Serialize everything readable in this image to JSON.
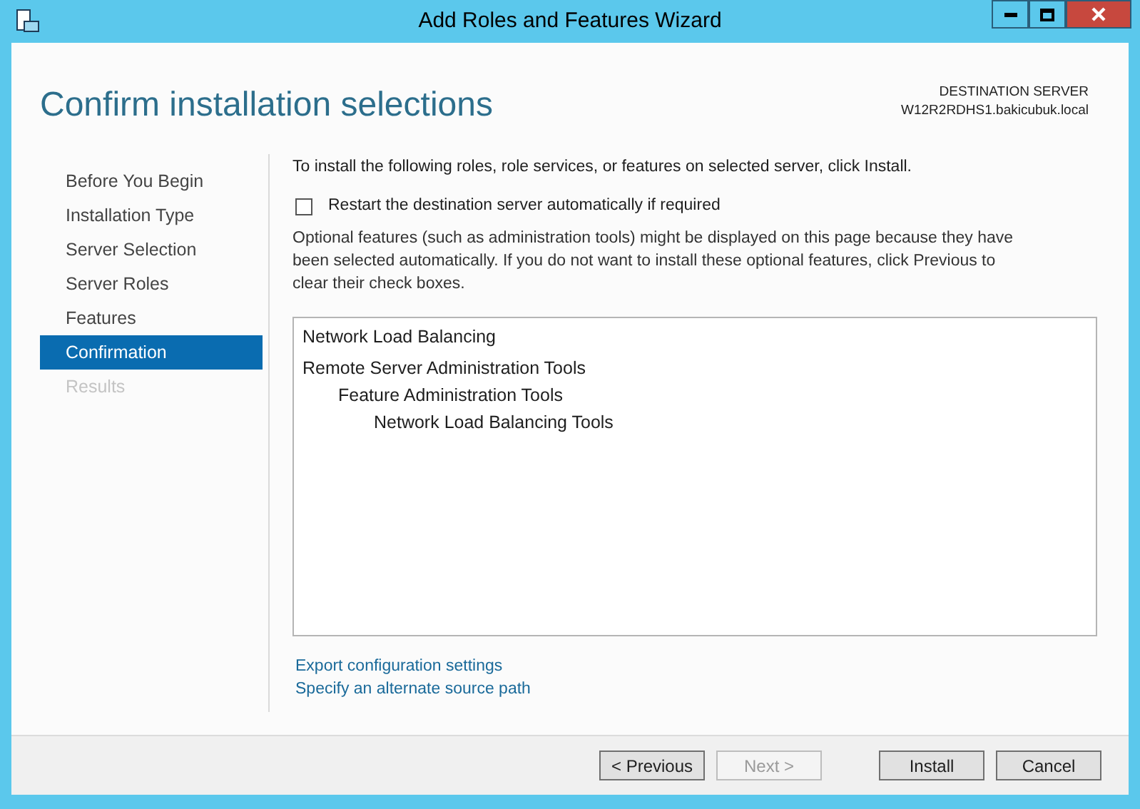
{
  "window": {
    "title": "Add Roles and Features Wizard"
  },
  "header": {
    "title": "Confirm installation selections",
    "destination_label": "DESTINATION SERVER",
    "destination_server": "W12R2RDHS1.bakicubuk.local"
  },
  "sidebar": {
    "items": [
      {
        "label": "Before You Begin",
        "selected": false,
        "disabled": false
      },
      {
        "label": "Installation Type",
        "selected": false,
        "disabled": false
      },
      {
        "label": "Server Selection",
        "selected": false,
        "disabled": false
      },
      {
        "label": "Server Roles",
        "selected": false,
        "disabled": false
      },
      {
        "label": "Features",
        "selected": false,
        "disabled": false
      },
      {
        "label": "Confirmation",
        "selected": true,
        "disabled": false
      },
      {
        "label": "Results",
        "selected": false,
        "disabled": true
      }
    ]
  },
  "content": {
    "intro": "To install the following roles, role services, or features on selected server, click Install.",
    "restart_checkbox": {
      "label": "Restart the destination server automatically if required",
      "checked": false
    },
    "note": "Optional features (such as administration tools) might be displayed on this page because they have been selected automatically. If you do not want to install these optional features, click Previous to clear their check boxes.",
    "selections": [
      {
        "label": "Network Load Balancing"
      },
      {
        "label": "Remote Server Administration Tools",
        "children": [
          {
            "label": "Feature Administration Tools",
            "children": [
              {
                "label": "Network Load Balancing Tools"
              }
            ]
          }
        ]
      }
    ],
    "links": [
      "Export configuration settings",
      "Specify an alternate source path"
    ]
  },
  "buttons": [
    {
      "label": "< Previous",
      "disabled": false
    },
    {
      "label": "Next >",
      "disabled": true
    },
    {
      "label": "Install",
      "disabled": false
    },
    {
      "label": "Cancel",
      "disabled": false
    }
  ]
}
